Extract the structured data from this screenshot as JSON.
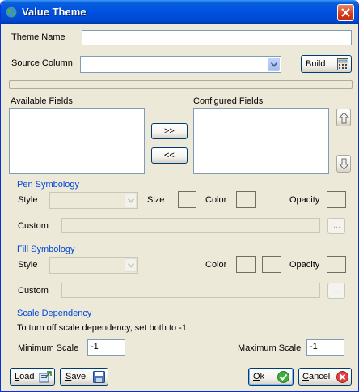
{
  "window": {
    "title": "Value Theme"
  },
  "form": {
    "theme_name_label": "Theme Name",
    "theme_name_value": "",
    "source_column_label": "Source Column",
    "source_column_value": "",
    "build_label": "Build",
    "available_fields_label": "Available Fields",
    "configured_fields_label": "Configured Fields",
    "add_label": ">>",
    "remove_label": "<<"
  },
  "pen": {
    "section_title": "Pen Symbology",
    "style_label": "Style",
    "size_label": "Size",
    "color_label": "Color",
    "opacity_label": "Opacity",
    "custom_label": "Custom",
    "browse_label": "..."
  },
  "fill": {
    "section_title": "Fill Symbology",
    "style_label": "Style",
    "color_label": "Color",
    "opacity_label": "Opacity",
    "custom_label": "Custom",
    "browse_label": "..."
  },
  "scale": {
    "section_title": "Scale Dependency",
    "hint": "To turn off scale dependency, set both to -1.",
    "min_label": "Minimum Scale",
    "min_value": "-1",
    "max_label": "Maximum Scale",
    "max_value": "-1"
  },
  "footer": {
    "load_first": "L",
    "load_rest": "oad",
    "save_first": "S",
    "save_rest": "ave",
    "ok_first": "O",
    "ok_rest": "k",
    "cancel_first": "C",
    "cancel_rest": "ancel"
  },
  "colors": {
    "section_title": "#0046d5",
    "titlebar": "#0054e3"
  }
}
